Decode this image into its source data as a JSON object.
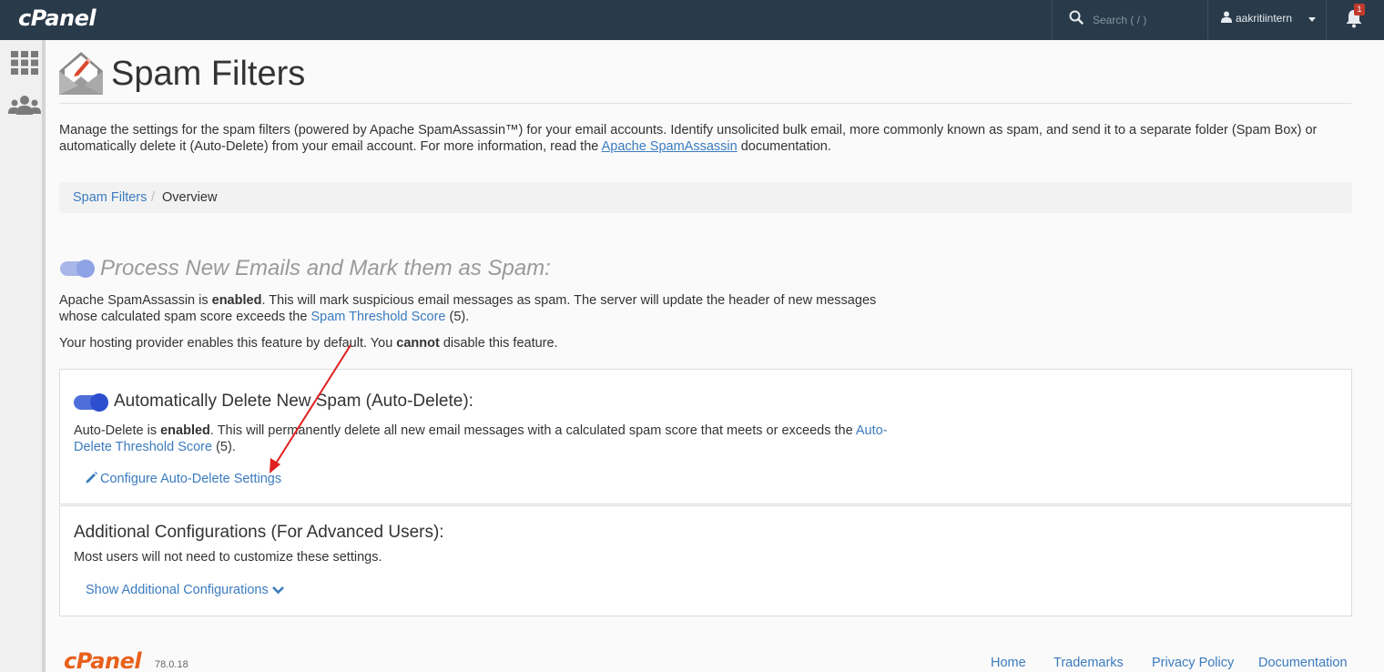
{
  "header": {
    "brand": "cPanel",
    "search_placeholder": "Search ( / )",
    "username": "aakritiintern",
    "notification_count": "1"
  },
  "page": {
    "title": "Spam Filters",
    "intro_part1": "Manage the settings for the spam filters (powered by Apache SpamAssassin™) for your email accounts. Identify unsolicited bulk email, more commonly known as spam, and send it to a separate folder (Spam Box) or automatically delete it (Auto-Delete) from your email account. For more information, read the ",
    "intro_link": "Apache SpamAssassin",
    "intro_part2": " documentation."
  },
  "breadcrumb": {
    "item1": "Spam Filters",
    "separator": "/",
    "item2": "Overview"
  },
  "process_section": {
    "title": "Process New Emails and Mark them as Spam:",
    "toggle_on": true,
    "p1_part1": "Apache SpamAssassin is ",
    "p1_bold": "enabled",
    "p1_part2": ". This will mark suspicious email messages as spam. The server will update the header of new messages whose calculated spam score exceeds the ",
    "p1_link": "Spam Threshold Score",
    "p1_part3": " (5).",
    "p2_part1": "Your hosting provider enables this feature by default. You ",
    "p2_bold": "cannot",
    "p2_part2": " disable this feature."
  },
  "auto_delete": {
    "title": "Automatically Delete New Spam (Auto-Delete):",
    "toggle_on": true,
    "text_part1": "Auto-Delete is ",
    "text_bold": "enabled",
    "text_part2": ". This will permanently delete all new email messages with a calculated spam score that meets or exceeds the ",
    "text_link": "Auto-Delete Threshold Score",
    "text_part3": " (5).",
    "configure_label": "Configure Auto-Delete Settings"
  },
  "additional": {
    "title": "Additional Configurations (For Advanced Users):",
    "text": "Most users will not need to customize these settings.",
    "show_label": "Show Additional Configurations"
  },
  "footer": {
    "brand": "cPanel",
    "version": "78.0.18",
    "links": [
      "Home",
      "Trademarks",
      "Privacy Policy",
      "Documentation"
    ]
  },
  "colors": {
    "topbar": "#293a4a",
    "link": "#3b7bbf",
    "toggle_on": "#2d4fcf",
    "annotation_arrow": "#e02020",
    "footer_brand": "#e8601c"
  }
}
